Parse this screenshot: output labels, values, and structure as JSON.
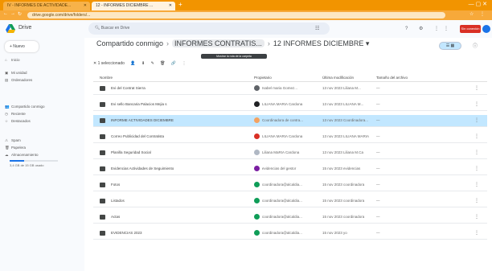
{
  "browser": {
    "tabs": [
      {
        "label": "IV - INFORMES DE ACTIVIDADE..."
      },
      {
        "label": "12 - INFORMES DICIEMBRE ..."
      }
    ],
    "new_tab": "+",
    "window_controls": "— ▢ ✕",
    "url": "drive.google.com/drive/folders/...",
    "nav": [
      "←",
      "→",
      "↻"
    ],
    "addr_icons": "☆ ⋮"
  },
  "drive": {
    "logo_text": "Drive",
    "search_placeholder": "Buscar en Drive",
    "badge": "Sin conexión",
    "new_label": "+ Nuevo"
  },
  "sidebar": {
    "items": [
      {
        "icon": "⌂",
        "label": "Inicio"
      },
      {
        "icon": "▣",
        "label": "Mi unidad"
      },
      {
        "icon": "▤",
        "label": "Ordenadores"
      },
      {
        "icon": "👥",
        "label": "Compartido conmigo"
      },
      {
        "icon": "◷",
        "label": "Reciente"
      },
      {
        "icon": "☆",
        "label": "Destacados"
      },
      {
        "icon": "⚠",
        "label": "Spam"
      },
      {
        "icon": "🗑",
        "label": "Papelera"
      },
      {
        "icon": "☁",
        "label": "Almacenamiento"
      }
    ],
    "storage_text": "3,4 GB de 15 GB usado"
  },
  "header": {
    "crumbs": [
      "Compartido conmigo",
      "INFORMES CONTRATIS...",
      "12 INFORMES DICIEMBRE"
    ],
    "tooltip": "Mostrar la ruta de la carpeta",
    "toggle": "☰ ▦",
    "info": "ⓘ"
  },
  "selection_bar": {
    "count": "1 seleccionado",
    "actions": [
      "👤",
      "⬇",
      "✎",
      "🗑",
      "🔗",
      "⋮"
    ]
  },
  "columns": {
    "name": "Nombre",
    "owner": "Propietario",
    "modified": "Última modificación",
    "size": "Tamaño del archivo"
  },
  "rows": [
    {
      "name": "Evi del Contrat Sierra",
      "owner": "Isabel maria Gomez...",
      "modified": "13 nov 2023 Liliana M...",
      "avatar_color": "#5f6368",
      "selected": false
    },
    {
      "name": "Evi sello Bancaria Palacios Mejia s",
      "owner": "LILIANA MARIA Cardona",
      "modified": "13 nov 2023 LILIANA M...",
      "avatar_color": "#202124",
      "selected": false
    },
    {
      "name": "INFORME ACTIVIDADES DICIEMBRE",
      "owner": "Coordinadora de contra...",
      "modified": "13 nov 2023 Coordinadora...",
      "avatar_color": "#f4a261",
      "selected": true
    },
    {
      "name": "Correo Publicidad del Contratista",
      "owner": "LILIANA MARIA Cardona",
      "modified": "13 nov 2023 LILIANA MARIA",
      "avatar_color": "#d93025",
      "selected": false
    },
    {
      "name": "Planilla Seguridad Social",
      "owner": "Liliana MaRIA Cardona",
      "modified": "13 nov 2023 Liliana M.Ca",
      "avatar_color": "#b0b8c4",
      "selected": false
    },
    {
      "name": "Evidencias Actividades de Seguimiento",
      "owner": "evidencias del gestor",
      "modified": "15 nov 2023 evidencias",
      "avatar_color": "#7b1fa2",
      "selected": false
    },
    {
      "name": "Fotos",
      "owner": "coordinadora@alcaldia...",
      "modified": "15 nov 2023 coordinadora",
      "avatar_color": "#0f9d58",
      "selected": false
    },
    {
      "name": "Listados",
      "owner": "coordinadora@alcaldia...",
      "modified": "15 nov 2023 coordinadora",
      "avatar_color": "#0f9d58",
      "selected": false
    },
    {
      "name": "Actas",
      "owner": "coordinadora@alcaldia...",
      "modified": "15 nov 2023 coordinadora",
      "avatar_color": "#0f9d58",
      "selected": false
    },
    {
      "name": "EVIDENCIAS 2023",
      "owner": "coordinadora@alcaldia...",
      "modified": "15 nov 2023 yo",
      "avatar_color": "#0f9d58",
      "selected": false
    }
  ],
  "row_more": "⋮",
  "size_dash": "—"
}
